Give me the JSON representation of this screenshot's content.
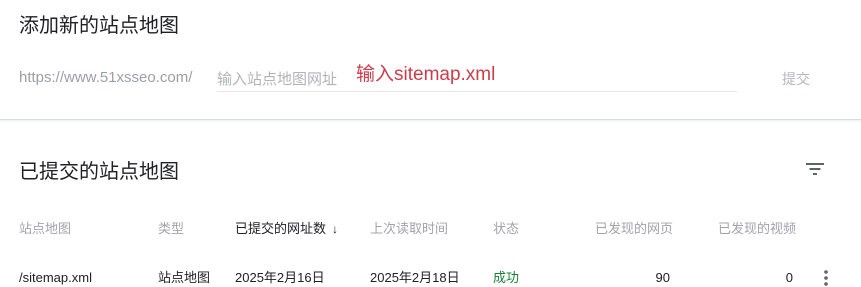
{
  "add_sitemap": {
    "title": "添加新的站点地图",
    "url_prefix": "https://www.51xsseo.com/",
    "input_placeholder": "输入站点地图网址",
    "input_value": "",
    "annotation": "输入sitemap.xml",
    "submit_label": "提交"
  },
  "submitted": {
    "title": "已提交的站点地图",
    "filter_icon": "filter-icon",
    "columns": {
      "sitemap": "站点地图",
      "type": "类型",
      "submitted_date": "已提交的网址数",
      "sort_arrow": "↓",
      "last_read": "上次读取时间",
      "status": "状态",
      "pages_found": "已发现的网页",
      "videos_found": "已发现的视频"
    },
    "rows": [
      {
        "sitemap": "/sitemap.xml",
        "type": "站点地图",
        "submitted_date": "2025年2月16日",
        "last_read": "2025年2月18日",
        "status": "成功",
        "pages_found": "90",
        "videos_found": "0"
      }
    ],
    "colors": {
      "status_success": "#188038",
      "annotation": "#cc3d4c"
    }
  }
}
